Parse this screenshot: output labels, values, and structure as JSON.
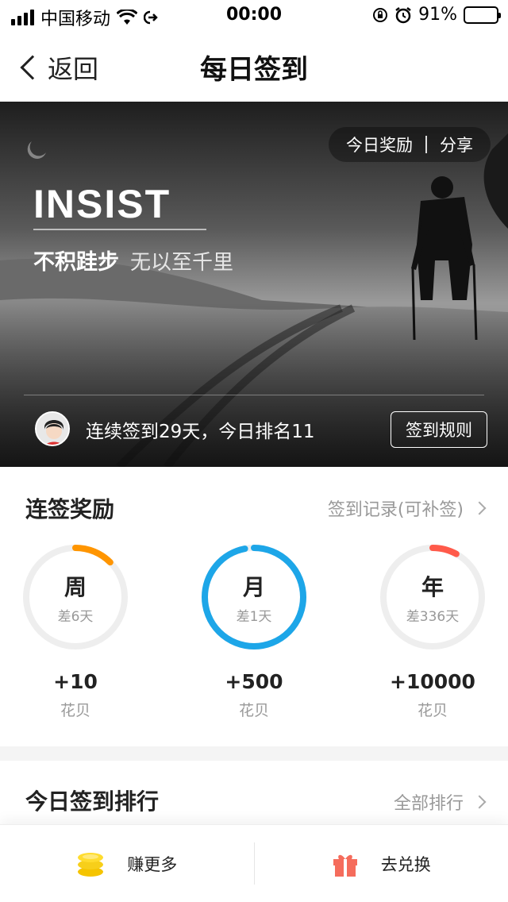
{
  "status_bar": {
    "carrier": "中国移动",
    "time": "00:00",
    "battery": "91%",
    "battery_level": 0.91
  },
  "nav": {
    "back_label": "返回",
    "title": "每日签到"
  },
  "hero": {
    "action_reward": "今日奖励",
    "action_share": "分享",
    "headline": "INSIST",
    "quote_bold": "不积跬步",
    "quote_light": "无以至千里",
    "streak_text": "连续签到29天，今日排名11",
    "rules_button": "签到规则"
  },
  "reward": {
    "title": "连签奖励",
    "link": "签到记录(可补签)",
    "items": [
      {
        "label": "周",
        "remaining": "差6天",
        "amount": "+10",
        "unit": "花贝",
        "progress": 0.125,
        "color": "#ff9500"
      },
      {
        "label": "月",
        "remaining": "差1天",
        "amount": "+500",
        "unit": "花贝",
        "progress": 0.97,
        "color": "#1da6e8"
      },
      {
        "label": "年",
        "remaining": "差336天",
        "amount": "+10000",
        "unit": "花贝",
        "progress": 0.08,
        "color": "#ff5a4a"
      }
    ]
  },
  "ranking": {
    "title": "今日签到排行",
    "link": "全部排行"
  },
  "bottom_bar": {
    "earn_label": "赚更多",
    "exchange_label": "去兑换"
  }
}
